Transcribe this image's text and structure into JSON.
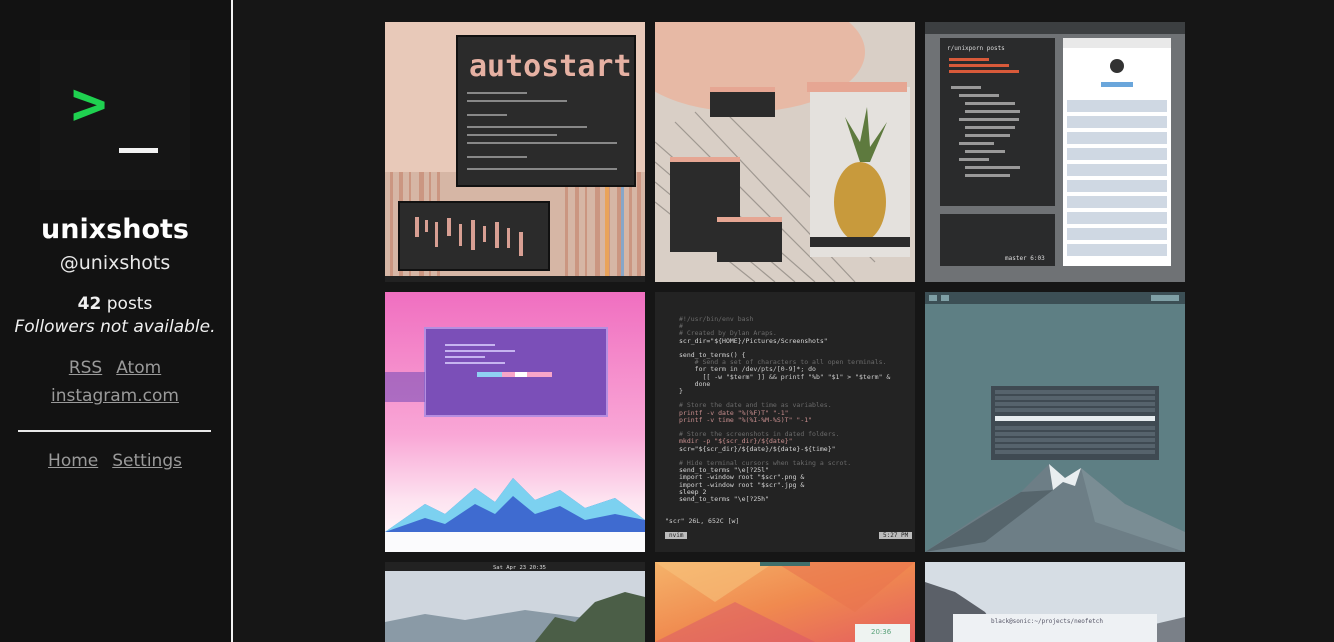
{
  "profile": {
    "logo_prompt": ">",
    "name": "unixshots",
    "handle": "@unixshots",
    "posts_count": "42",
    "posts_label": "posts",
    "followers_text": "Followers not available."
  },
  "links": {
    "rss": "RSS",
    "atom": "Atom",
    "instagram": "instagram.com"
  },
  "nav": {
    "home": "Home",
    "settings": "Settings"
  },
  "tiles": [
    {
      "alt": "autostart",
      "title": "autostart"
    },
    {
      "alt": "pineapple desktop"
    },
    {
      "alt": "reddit terminal",
      "title": "r/unixporn posts",
      "status": "master 6:03"
    },
    {
      "alt": "pink mountains"
    },
    {
      "alt": "screenshot script",
      "code": [
        "#!/usr/bin/env bash",
        "#",
        "# Created by Dylan Araps.",
        "scr_dir=\"${HOME}/Pictures/Screenshots\"",
        "",
        "send_to_terms() {",
        "    # Send a set of characters to all open terminals.",
        "    for term in /dev/pts/[0-9]*; do",
        "      [[ -w \"$term\" ]] && printf \"%b\" \"$1\" > \"$term\" &",
        "    done",
        "}",
        "",
        "# Store the date and time as variables.",
        "printf -v date \"%(%F)T\" \"-1\"",
        "printf -v time \"%(%I-%M-%S)T\" \"-1\"",
        "",
        "# Store the screenshots in dated folders.",
        "mkdir -p \"${scr_dir}/${date}\"",
        "scr=\"${scr_dir}/${date}/${date}-${time}\"",
        "",
        "# Hide terminal cursors when taking a scrot.",
        "send_to_terms \"\\e[?25l\"",
        "import -window root \"$scr\".png &",
        "import -window root \"$scr\".jpg &",
        "sleep 2",
        "send_to_terms \"\\e[?25h\""
      ],
      "file_info": "\"scr\" 26L, 652C [w]",
      "mode": "nvim",
      "clock": "5:27 PM"
    },
    {
      "alt": "mountain rofi"
    },
    {
      "alt": "clouds",
      "bar_date": "Sat Apr 23  20:35"
    },
    {
      "alt": "orange wallpaper",
      "clock": "20:36"
    },
    {
      "alt": "mountain terminal",
      "title": "black@sonic:~/projects/neofetch"
    }
  ]
}
